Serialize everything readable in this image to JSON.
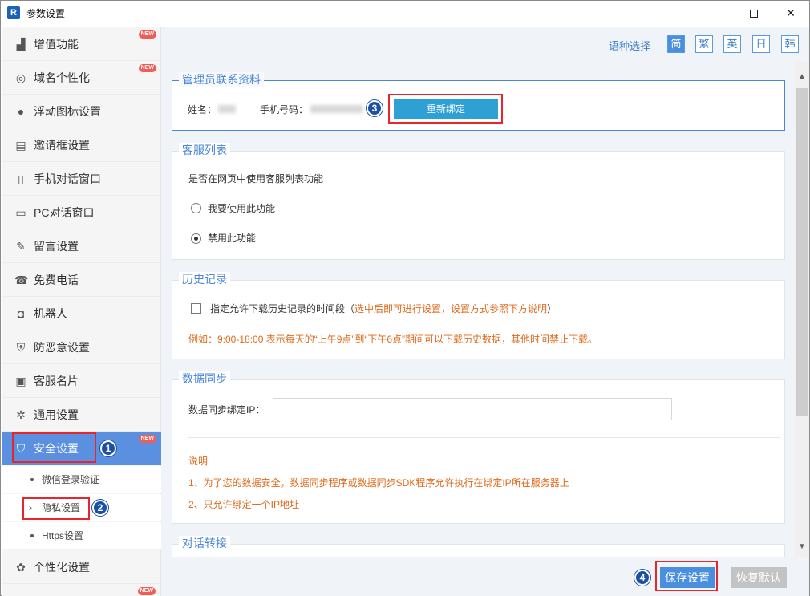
{
  "window": {
    "title": "参数设置",
    "app_icon": "R",
    "minimize": "—",
    "close": "✕"
  },
  "sidebar": {
    "items": [
      {
        "label": "增值功能",
        "icon": "bar-chart-icon",
        "new": true
      },
      {
        "label": "域名个性化",
        "icon": "globe-icon",
        "new": true
      },
      {
        "label": "浮动图标设置",
        "icon": "bulb-icon",
        "new": false
      },
      {
        "label": "邀请框设置",
        "icon": "document-icon",
        "new": false
      },
      {
        "label": "手机对话窗口",
        "icon": "mobile-icon",
        "new": false
      },
      {
        "label": "PC对话窗口",
        "icon": "monitor-icon",
        "new": false
      },
      {
        "label": "留言设置",
        "icon": "edit-icon",
        "new": false
      },
      {
        "label": "免费电话",
        "icon": "phone-icon",
        "new": false
      },
      {
        "label": "机器人",
        "icon": "robot-icon",
        "new": false
      },
      {
        "label": "防恶意设置",
        "icon": "shield-plus-icon",
        "new": false
      },
      {
        "label": "客服名片",
        "icon": "card-icon",
        "new": false
      },
      {
        "label": "通用设置",
        "icon": "gear-icon",
        "new": false
      },
      {
        "label": "安全设置",
        "icon": "shield-icon",
        "new": true
      },
      {
        "label": "个性化设置",
        "icon": "palette-icon",
        "new": false
      }
    ],
    "new_badge": "NEW",
    "subitems": [
      {
        "label": "微信登录验证"
      },
      {
        "label": "隐私设置"
      },
      {
        "label": "Https设置"
      }
    ]
  },
  "lang": {
    "label": "语种选择",
    "options": [
      "简",
      "繁",
      "英",
      "日",
      "韩"
    ],
    "selected": "简"
  },
  "admin": {
    "legend": "管理员联系资料",
    "name_label": "姓名：",
    "phone_label": "手机号码：",
    "rebind": "重新绑定"
  },
  "service_list": {
    "legend": "客服列表",
    "question": "是否在网页中使用客服列表功能",
    "options": [
      "我要使用此功能",
      "禁用此功能"
    ],
    "selected": "禁用此功能"
  },
  "history": {
    "legend": "历史记录",
    "checkbox_label": "指定允许下载历史记录的时间段（",
    "hint": "选中后即可进行设置，设置方式参照下方说明",
    "hint_close": "）",
    "example": "例如：9:00-18:00 表示每天的“上午9点”到“下午6点”期间可以下载历史数据，其他时间禁止下载。"
  },
  "sync": {
    "legend": "数据同步",
    "ip_label": "数据同步绑定IP：",
    "ip_value": "",
    "note_title": "说明:",
    "notes": [
      "1、为了您的数据安全，数据同步程序或数据同步SDK程序允许执行在绑定IP所在服务器上",
      "2、只允许绑定一个IP地址"
    ]
  },
  "transfer": {
    "legend": "对话转接"
  },
  "footer": {
    "save": "保存设置",
    "reset": "恢复默认"
  },
  "markers": [
    "1",
    "2",
    "3",
    "4"
  ],
  "colors": {
    "accent": "#4a8fde",
    "sidebar_active": "#5b8fe0",
    "rebind": "#2fa0d6",
    "orange_text": "#e06a1b",
    "highlight_box": "#e8252b",
    "marker": "#1b4fa6"
  }
}
